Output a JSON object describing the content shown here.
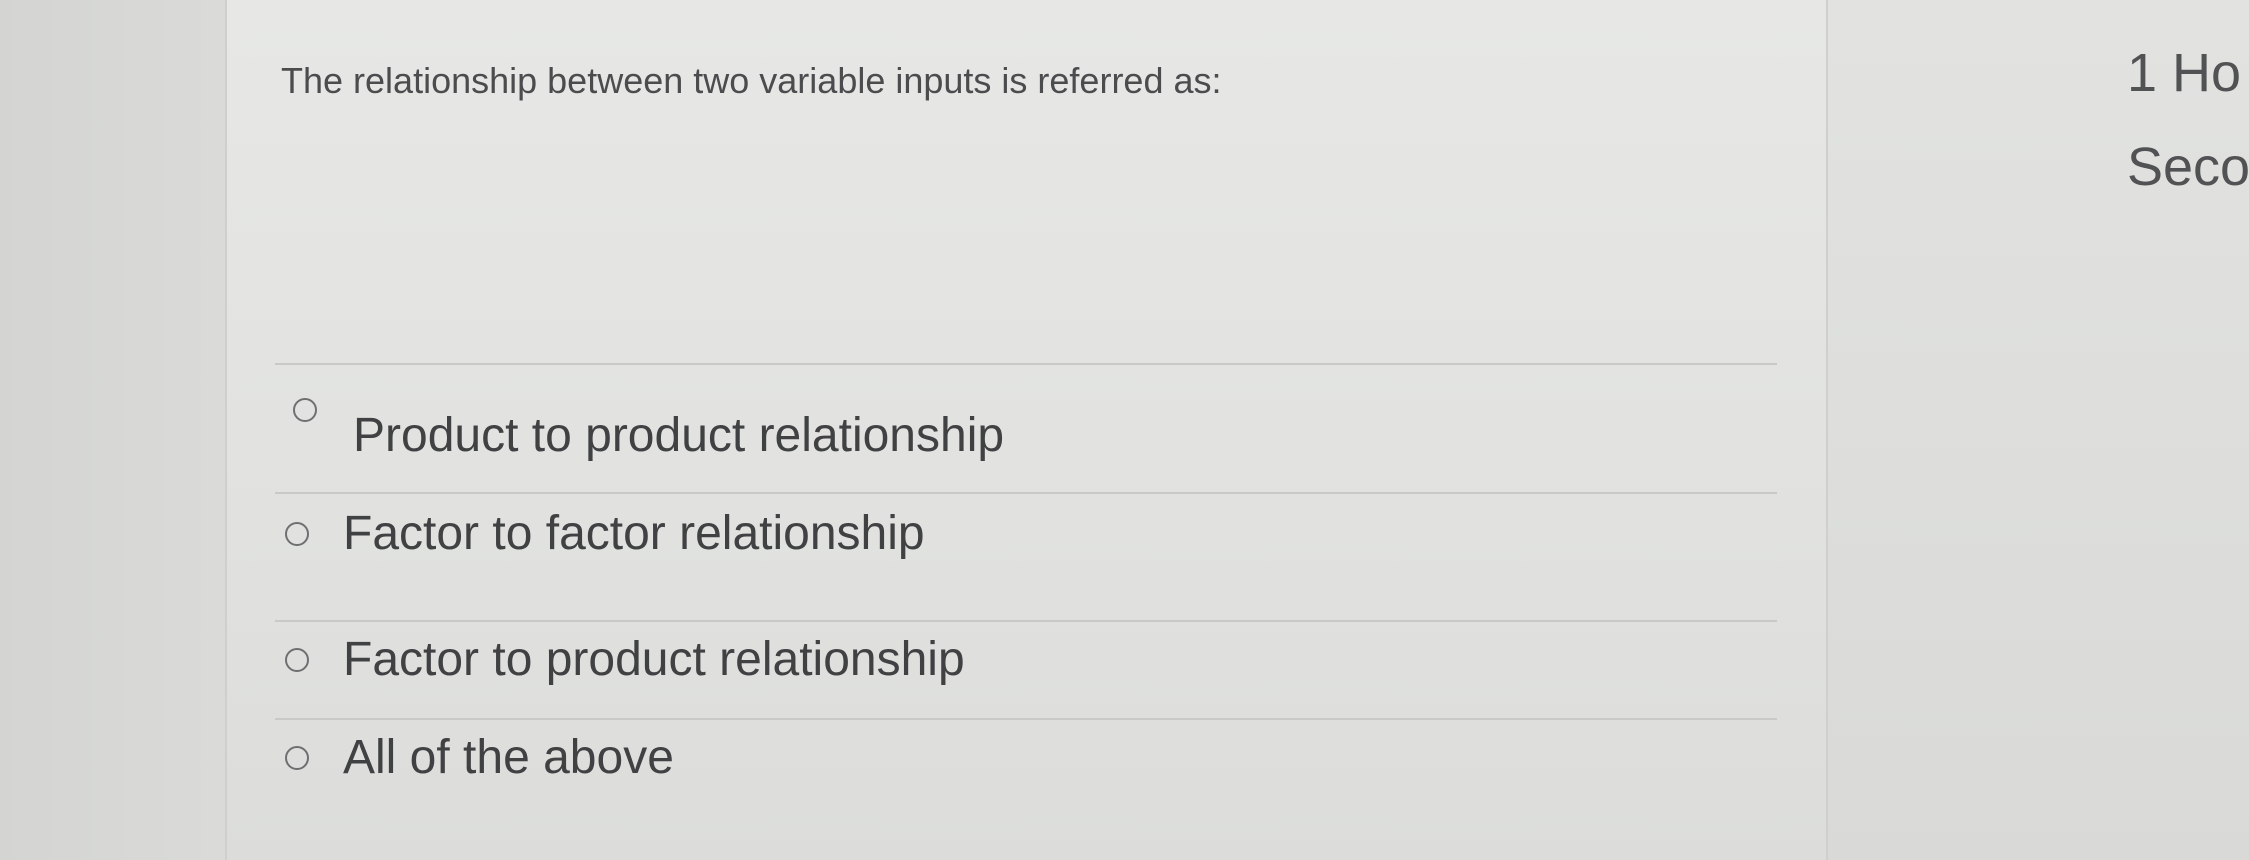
{
  "question": {
    "text": "The relationship between two variable inputs is referred as:"
  },
  "options": [
    {
      "label": "Product to product relationship",
      "selected": false
    },
    {
      "label": "Factor to factor relationship",
      "selected": false
    },
    {
      "label": "Factor to product relationship",
      "selected": false
    },
    {
      "label": "All of the above",
      "selected": false
    }
  ],
  "side_panel": {
    "line1": "1 Ho",
    "line2": "Seco"
  },
  "colors": {
    "background": "#e4e5e3",
    "text": "#3f4143",
    "divider": "#c9cac8",
    "radio_border": "#6d6f71"
  }
}
